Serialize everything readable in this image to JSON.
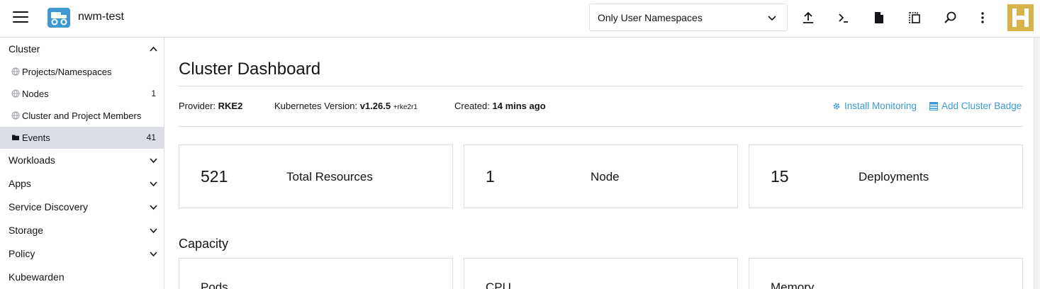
{
  "header": {
    "cluster_name": "nwm-test",
    "namespace_filter": "Only User Namespaces"
  },
  "sidebar": {
    "groups": [
      {
        "label": "Cluster",
        "expanded": true
      },
      {
        "label": "Workloads"
      },
      {
        "label": "Apps"
      },
      {
        "label": "Service Discovery"
      },
      {
        "label": "Storage"
      },
      {
        "label": "Policy"
      },
      {
        "label": "Kubewarden"
      }
    ],
    "items": [
      {
        "label": "Projects/Namespaces",
        "count": ""
      },
      {
        "label": "Nodes",
        "count": "1"
      },
      {
        "label": "Cluster and Project Members",
        "count": ""
      },
      {
        "label": "Events",
        "count": "41",
        "active": true
      }
    ]
  },
  "main": {
    "title": "Cluster Dashboard",
    "provider_label": "Provider:",
    "provider_value": "RKE2",
    "k8s_label": "Kubernetes Version:",
    "k8s_value": "v1.26.5",
    "k8s_suffix": "+rke2r1",
    "created_label": "Created:",
    "created_value": "14 mins ago",
    "install_monitoring": "Install Monitoring",
    "add_cluster_badge": "Add Cluster Badge",
    "cards": [
      {
        "value": "521",
        "label": "Total Resources"
      },
      {
        "value": "1",
        "label": "Node"
      },
      {
        "value": "15",
        "label": "Deployments"
      }
    ],
    "capacity_title": "Capacity",
    "capacity_cards": [
      "Pods",
      "CPU",
      "Memory"
    ]
  },
  "colors": {
    "accent": "#3d98d3",
    "brand": "#d8b24a",
    "active_bg": "#dcdee7"
  }
}
